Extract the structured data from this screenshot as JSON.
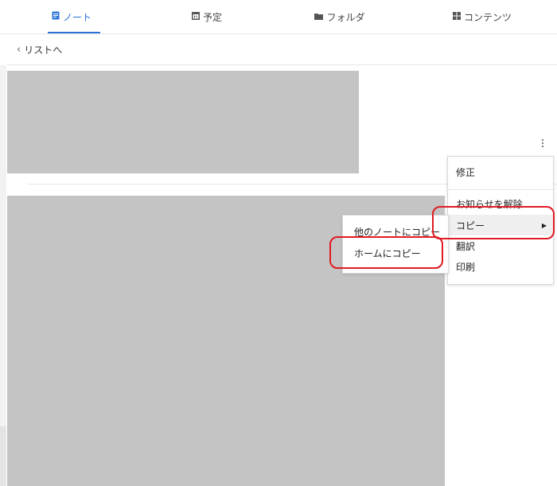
{
  "tabs": [
    {
      "label": "ノート",
      "icon": "note-icon",
      "active": true
    },
    {
      "label": "予定",
      "icon": "calendar-icon",
      "active": false
    },
    {
      "label": "フォルダ",
      "icon": "folder-icon",
      "active": false
    },
    {
      "label": "コンテンツ",
      "icon": "grid-icon",
      "active": false
    }
  ],
  "subbar": {
    "back_label": "リストへ",
    "back_icon": "chevron-left-icon"
  },
  "more_icon": "kebab-menu-icon",
  "context_menu": {
    "items": [
      "修正",
      "お知らせを解除",
      "コピー",
      "翻訳",
      "印刷"
    ],
    "has_submenu_icon": "caret-right-icon"
  },
  "copy_submenu": {
    "items": [
      "他のノートにコピー",
      "ホームにコピー"
    ]
  },
  "colors": {
    "accent": "#2b73d6",
    "annotation": "#e01b24",
    "placeholder": "#c4c4c4"
  }
}
